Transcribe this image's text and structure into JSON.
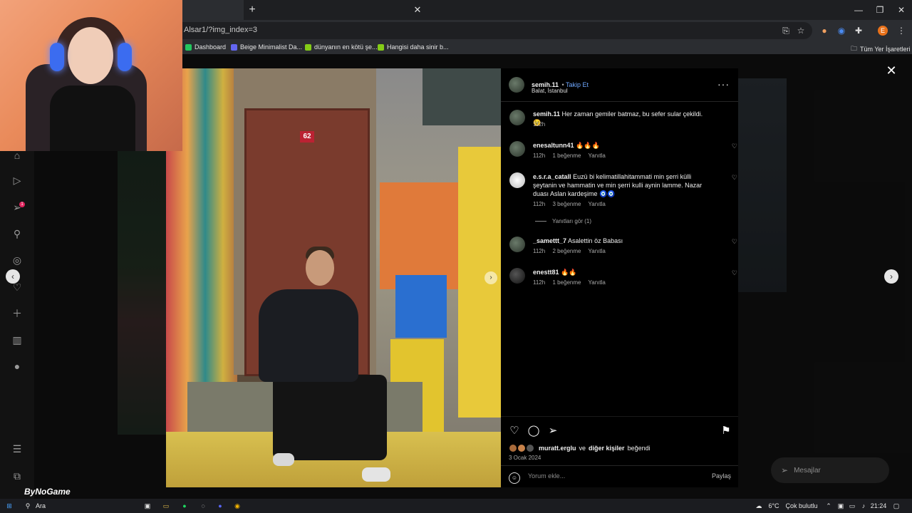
{
  "browser": {
    "url": "Alsar1/?img_index=3",
    "new_tab": "+",
    "window_controls": [
      "—",
      "❐",
      "✕"
    ],
    "bookmarks": [
      {
        "label": "Dashboard",
        "color": "#22c55e"
      },
      {
        "label": "Beige Minimalist Da...",
        "color": "#6366f1"
      },
      {
        "label": "dünyanın en kötü şe...",
        "color": "#84cc16"
      },
      {
        "label": "Hangisi daha sinir b...",
        "color": "#84cc16"
      }
    ],
    "all_bookmarks": "Tüm Yer İşaretleri",
    "profile_initial": "E",
    "profile_color": "#e8711a"
  },
  "post": {
    "username": "semih.11",
    "follow_label": "Takip Et",
    "location": "Balat, İstanbul",
    "door_number": "62",
    "more_label": "···"
  },
  "comments": [
    {
      "user": "semih.11",
      "text": "Her zaman gemiler batmaz, bu sefer sular çekildi. 😉",
      "time": "112h",
      "likes": "",
      "reply": ""
    },
    {
      "user": "enesaltunn41",
      "text": "🔥🔥🔥",
      "time": "112h",
      "likes": "1 beğenme",
      "reply": "Yanıtla"
    },
    {
      "user": "e.s.r.a_catall",
      "text": "Euzü bi kelimatillahitammati min şerri külli şeytanin ve hammatin ve min şerri kulli aynin lamme. Nazar duası Aslan kardeşime 🧿🧿",
      "time": "112h",
      "likes": "3 beğenme",
      "reply": "Yanıtla"
    },
    {
      "user": "_samettt_7",
      "text": "Asalettin öz Babası",
      "time": "112h",
      "likes": "2 beğenme",
      "reply": "Yanıtla"
    },
    {
      "user": "enestt81",
      "text": "🔥🔥",
      "time": "112h",
      "likes": "1 beğenme",
      "reply": "Yanıtla"
    }
  ],
  "replies_label": "Yanıtları gör (1)",
  "likes": {
    "user": "muratt.erglu",
    "connector": "ve",
    "others": "diğer kişiler",
    "suffix": "beğendi"
  },
  "date": "3 Ocak 2024",
  "add_comment": {
    "placeholder": "Yorum ekle...",
    "share": "Paylaş"
  },
  "messages_label": "Mesajlar",
  "watermark": "ByNoGame",
  "nav_badge": "1",
  "taskbar": {
    "search": "Ara",
    "weather": "6°C",
    "weather_text": "Çok bulutlu",
    "time": "21:24"
  },
  "colors": {
    "accent": "#6fa8ff",
    "panel_bg": "#000000"
  }
}
